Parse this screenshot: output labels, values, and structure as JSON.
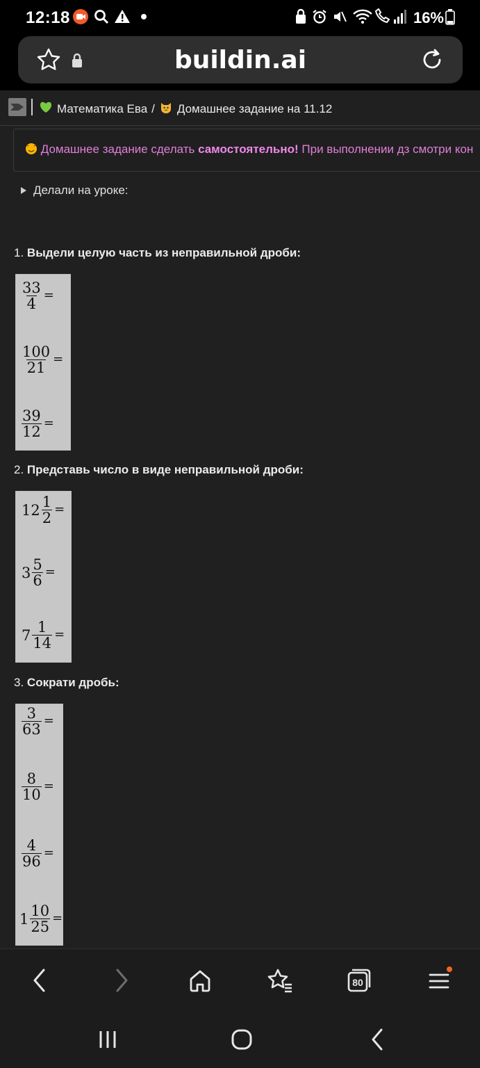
{
  "status": {
    "time": "12:18",
    "battery": "16%"
  },
  "browser": {
    "url": "buildin.ai"
  },
  "breadcrumb": {
    "workspace": "Математика Ева",
    "separator": "/",
    "page": "Домашнее задание на 11.12"
  },
  "callout": {
    "part1": "Домашнее задание сделать ",
    "bold": "самостоятельно!",
    "part2": " При выполнении дз смотри кон"
  },
  "toggle": {
    "label": "Делали на уроке:"
  },
  "tasks": [
    {
      "number": "1.",
      "title": "Выдели целую часть из неправильной дроби:",
      "items": [
        {
          "whole": "",
          "num": "33",
          "den": "4",
          "eq": "="
        },
        {
          "whole": "",
          "num": "100",
          "den": "21",
          "eq": "="
        },
        {
          "whole": "",
          "num": "39",
          "den": "12",
          "eq": "="
        }
      ]
    },
    {
      "number": "2.",
      "title": "Представь число в виде неправильной дроби:",
      "items": [
        {
          "whole": "12",
          "num": "1",
          "den": "2",
          "eq": "="
        },
        {
          "whole": "3",
          "num": "5",
          "den": "6",
          "eq": "="
        },
        {
          "whole": "7",
          "num": "1",
          "den": "14",
          "eq": "="
        }
      ]
    },
    {
      "number": "3.",
      "title": "Сократи дробь:",
      "items": [
        {
          "whole": "",
          "num": "3",
          "den": "63",
          "eq": "="
        },
        {
          "whole": "",
          "num": "8",
          "den": "10",
          "eq": "="
        },
        {
          "whole": "",
          "num": "4",
          "den": "96",
          "eq": "="
        },
        {
          "whole": "1",
          "num": "10",
          "den": "25",
          "eq": "="
        }
      ]
    }
  ],
  "nav": {
    "tabs_count": "80"
  },
  "colors": {
    "background": "#202020",
    "callout_text": "#e07fd9",
    "math_box": "#c7c7c7",
    "notification_dot": "#f26522"
  },
  "icons": [
    "screen-record-icon",
    "search-icon",
    "warning-icon",
    "dot-icon",
    "lock-icon",
    "alarm-icon",
    "mute-icon",
    "wifi-icon",
    "wifi-call-icon",
    "signal-icon",
    "battery-icon",
    "star-icon",
    "padlock-icon",
    "reload-icon",
    "sidebar-toggle-icon",
    "green-heart-icon",
    "cat-icon",
    "smiling-hearts-icon",
    "triangle-right-icon",
    "back-icon",
    "forward-icon",
    "home-icon",
    "bookmarks-icon",
    "tabs-icon",
    "menu-icon",
    "recent-apps-icon",
    "home-circle-icon",
    "system-back-icon"
  ]
}
